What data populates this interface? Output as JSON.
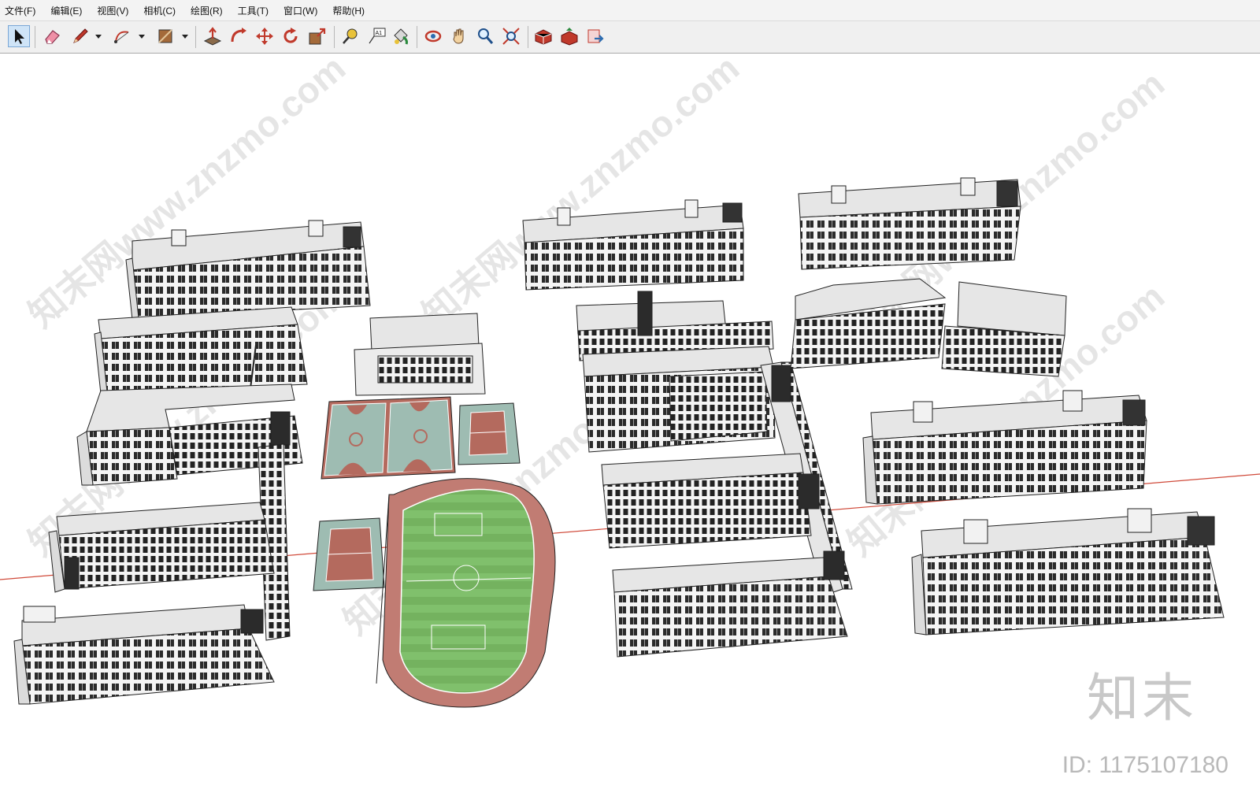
{
  "menu": {
    "file": "文件(F)",
    "edit": "编辑(E)",
    "view": "视图(V)",
    "camera": "相机(C)",
    "draw": "绘图(R)",
    "tools": "工具(T)",
    "window": "窗口(W)",
    "help": "帮助(H)"
  },
  "toolbar": {
    "tools": [
      "select-icon",
      "eraser-icon",
      "pencil-icon",
      "arc-icon",
      "rectangle-icon",
      "push-pull-icon",
      "follow-me-icon",
      "move-icon",
      "rotate-icon",
      "scale-icon",
      "tape-measure-icon",
      "text-icon",
      "paint-bucket-icon",
      "orbit-icon",
      "pan-icon",
      "zoom-icon",
      "zoom-extents-icon",
      "warehouse-icon",
      "share-model-icon",
      "extension-icon"
    ],
    "text_tool_label": "A1"
  },
  "viewport": {
    "watermark": "知末网www.znzmo.com",
    "logo": "知末",
    "id_label": "ID: 1175107180"
  },
  "colors": {
    "wall": "#f0f0f0",
    "roof": "#e2e2e2",
    "court_red": "#b8695e",
    "court_teal": "#9fbdb4",
    "field_green": "#7fbf6a",
    "track": "#c07b72",
    "axis_red": "#c0392b"
  }
}
